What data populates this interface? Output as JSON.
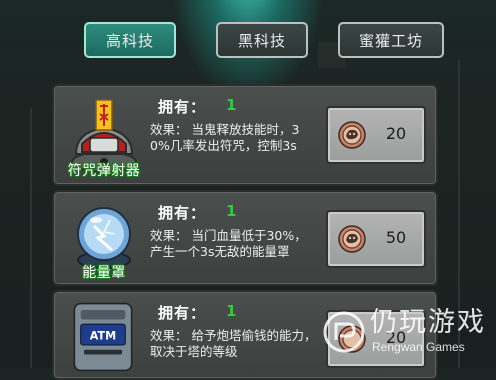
{
  "tabs": [
    {
      "label": "高科技",
      "active": true
    },
    {
      "label": "黑科技",
      "active": false
    },
    {
      "label": "蜜獾工坊",
      "active": false
    }
  ],
  "items": [
    {
      "name": "符咒弹射器",
      "icon": "talisman-launcher-icon",
      "own_label": "拥有：",
      "own_value": "1",
      "effect": "效果：   当鬼释放技能时，30%几率发出符咒，控制3s",
      "price": "20"
    },
    {
      "name": "能量罩",
      "icon": "energy-shield-orb-icon",
      "own_label": "拥有：",
      "own_value": "1",
      "effect": "效果：   当门血量低于30%，产生一个3s无敌的能量罩",
      "price": "50"
    },
    {
      "name": "",
      "icon": "atm-machine-icon",
      "icon_text": "ATM",
      "own_label": "拥有：",
      "own_value": "1",
      "effect": "效果：   给予炮塔偷钱的能力，取决于塔的等级",
      "price": "20"
    }
  ],
  "watermark": {
    "title": "仍玩游戏",
    "subtitle": "Rengwan Games",
    "icon": "rengwan-logo-icon"
  },
  "colors": {
    "own_value": "#39c93f",
    "active_tab": "#2e8d7e",
    "price_button": "#a9aaa9"
  }
}
